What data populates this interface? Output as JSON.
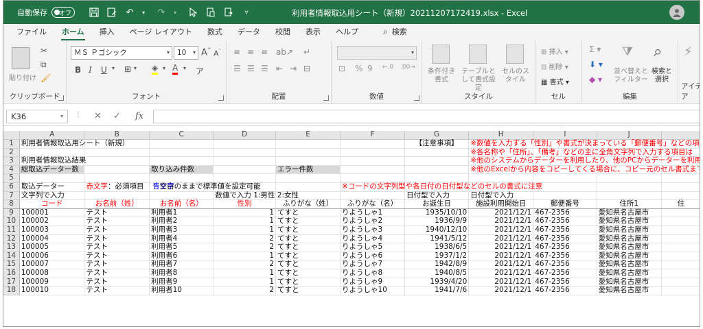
{
  "title_bar": {
    "autosave_label": "自動保存",
    "autosave_state": "オフ",
    "document_title": "利用者情報取込用シート（新規）20211207172419.xlsx  -  Excel",
    "brand_color": "#217346"
  },
  "tabs": [
    "ファイル",
    "ホーム",
    "挿入",
    "ページ レイアウト",
    "数式",
    "データ",
    "校閲",
    "表示",
    "ヘルプ"
  ],
  "search_label": "検索",
  "ribbon": {
    "clipboard": {
      "paste": "貼り付け",
      "label": "クリップボード"
    },
    "font": {
      "name": "ＭＳ Ｐゴシック",
      "size": "10",
      "grow": "A",
      "shrink": "A",
      "bold": "B",
      "italic": "I",
      "underline": "U",
      "label": "フォント"
    },
    "alignment": {
      "label": "配置"
    },
    "number": {
      "label": "数値"
    },
    "styles": {
      "conditional": "条件付き書式",
      "table": "テーブルとして書式設定",
      "cell": "セルのスタイル",
      "label": "スタイル"
    },
    "cells": {
      "insert": "挿入",
      "delete": "削除",
      "format": "書式",
      "label": "セル"
    },
    "editing": {
      "sort": "並べ替えとフィルター",
      "find": "検索と選択",
      "label": "編集"
    },
    "ideas": {
      "label": "アイデア"
    }
  },
  "formula_bar": {
    "name_box": "K36",
    "formula": ""
  },
  "columns": [
    "A",
    "B",
    "C",
    "D",
    "E",
    "F",
    "G",
    "H",
    "I",
    "J"
  ],
  "sheet": {
    "row1": {
      "a": "利用者情報取込用シート（新規）",
      "g": "【注意事項】",
      "h": "※数値を入力する「性別」や書式が決まっている「郵便番号」などの項"
    },
    "row2": {
      "h": "※各名称や「住所」、「備考」などの主に全角文字列で入力する項目は"
    },
    "row3": {
      "a": "利用者情報取込結果",
      "h": "※他のシステムからデーターを利用したり、他のPCからデーターを利用"
    },
    "row4": {
      "a": "総取込データー数",
      "c": "取り込み件数",
      "e": "エラー件数",
      "h": "※他のExcelから内容をコピーしてくる場合に、コピー元のセル書式まで"
    },
    "row6": {
      "a": "取込データー",
      "b_red": "赤文字",
      "b_rest": "：必須項目",
      "c_blue": "青文字",
      "c_rest": "：空白のままで標準値を設定可能",
      "f": "※コードの文字列型や各日付の日付型などのセルの書式に注意"
    },
    "row7": {
      "a": "文字列で入力",
      "d": "数値で入力 1:男性 2:女性",
      "g": "日付型で入力",
      "h": "日付型で入力"
    },
    "headers": [
      "コード",
      "お名前（姓）",
      "お名前（名）",
      "性別",
      "ふりがな（姓）",
      "ふりがな（名）",
      "お誕生日",
      "施設利用開始日",
      "郵便番号",
      "住所1",
      "住"
    ],
    "records": [
      [
        "100001",
        "テスト",
        "利用者1",
        "1",
        "てすと",
        "りようしゃ1",
        "1935/10/10",
        "2021/12/1",
        "467-2356",
        "愛知県名古屋市"
      ],
      [
        "100002",
        "テスト",
        "利用者2",
        "1",
        "てすと",
        "りようしゃ2",
        "1936/9/9",
        "2021/12/1",
        "467-2356",
        "愛知県名古屋市"
      ],
      [
        "100003",
        "テスト",
        "利用者3",
        "1",
        "てすと",
        "りようしゃ3",
        "1940/12/10",
        "2021/12/1",
        "467-2356",
        "愛知県名古屋市"
      ],
      [
        "100004",
        "テスト",
        "利用者4",
        "2",
        "てすと",
        "りようしゃ4",
        "1941/5/12",
        "2021/12/1",
        "467-2356",
        "愛知県名古屋市"
      ],
      [
        "100005",
        "テスト",
        "利用者5",
        "2",
        "てすと",
        "りようしゃ5",
        "1938/6/5",
        "2021/12/1",
        "467-2356",
        "愛知県名古屋市"
      ],
      [
        "100006",
        "テスト",
        "利用者6",
        "1",
        "てすと",
        "りようしゃ6",
        "1937/1/2",
        "2021/12/1",
        "467-2356",
        "愛知県名古屋市"
      ],
      [
        "100007",
        "テスト",
        "利用者7",
        "2",
        "てすと",
        "りようしゃ7",
        "1942/8/9",
        "2021/12/1",
        "467-2356",
        "愛知県名古屋市"
      ],
      [
        "100008",
        "テスト",
        "利用者8",
        "1",
        "てすと",
        "りようしゃ8",
        "1940/8/5",
        "2021/12/1",
        "467-2356",
        "愛知県名古屋市"
      ],
      [
        "100009",
        "テスト",
        "利用者9",
        "1",
        "てすと",
        "りようしゃ9",
        "1939/4/20",
        "2021/12/1",
        "467-2356",
        "愛知県名古屋市"
      ],
      [
        "100010",
        "テスト",
        "利用者10",
        "2",
        "てすと",
        "りようしゃ10",
        "1941/7/6",
        "2021/12/1",
        "467-2356",
        "愛知県名古屋市"
      ]
    ]
  }
}
